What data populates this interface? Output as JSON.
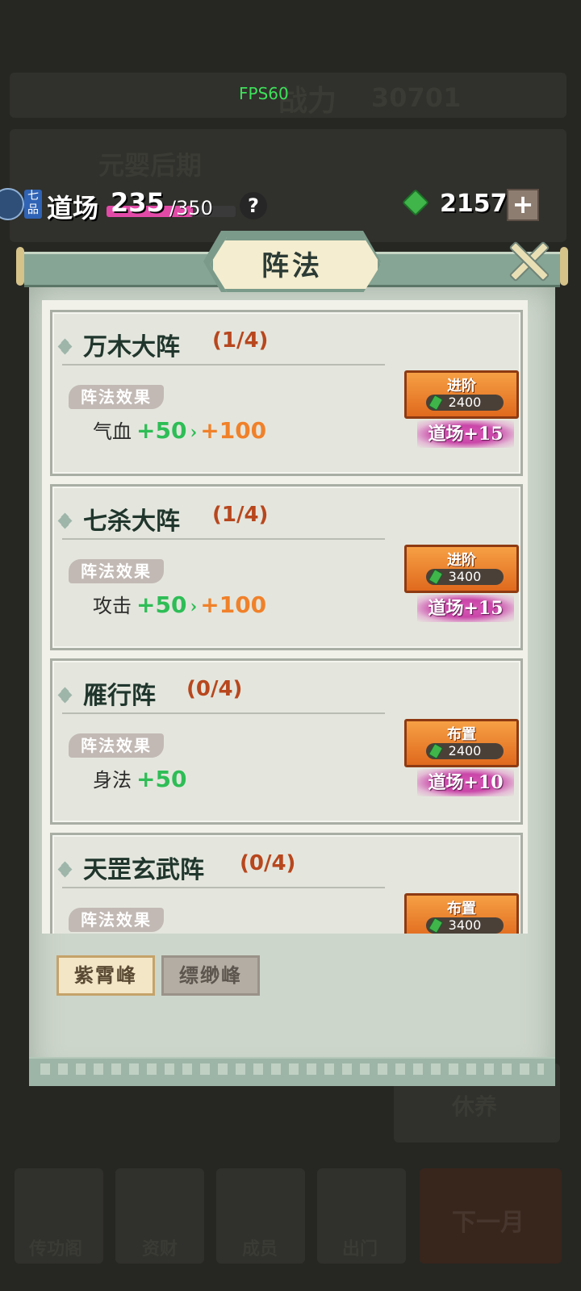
{
  "fps": "FPS60",
  "background": {
    "power_label": "战力",
    "power_value": "30701",
    "realm": "元婴后期",
    "rest_label": "休养",
    "next_month": "下一月",
    "bottom_tabs": [
      "传功阁",
      "资财",
      "成员",
      "出门"
    ]
  },
  "topbar": {
    "rank": "七品",
    "dao_label": "道场",
    "dao_current": "235",
    "dao_max": "/350",
    "dao_progress": 0.67,
    "help": "?",
    "gem_count": "2157",
    "plus": "+"
  },
  "modal": {
    "title": "阵法",
    "formations": [
      {
        "name": "万木大阵",
        "progress": "(1/4)",
        "effect_tag": "阵法效果",
        "stat": "气血",
        "value": "+50",
        "next_value": "+100",
        "action": "进阶",
        "cost": "2400",
        "bonus": "道场+15"
      },
      {
        "name": "七杀大阵",
        "progress": "(1/4)",
        "effect_tag": "阵法效果",
        "stat": "攻击",
        "value": "+50",
        "next_value": "+100",
        "action": "进阶",
        "cost": "3400",
        "bonus": "道场+15"
      },
      {
        "name": "雁行阵",
        "progress": "(0/4)",
        "effect_tag": "阵法效果",
        "stat": "身法",
        "value": "+50",
        "next_value": "",
        "action": "布置",
        "cost": "2400",
        "bonus": "道场+10"
      },
      {
        "name": "天罡玄武阵",
        "progress": "(0/4)",
        "effect_tag": "阵法效果",
        "stat": "",
        "value": "",
        "next_value": "",
        "action": "布置",
        "cost": "3400",
        "bonus": ""
      }
    ],
    "peak_tabs": [
      {
        "label": "紫霄峰",
        "active": true
      },
      {
        "label": "缥缈峰",
        "active": false
      }
    ]
  }
}
